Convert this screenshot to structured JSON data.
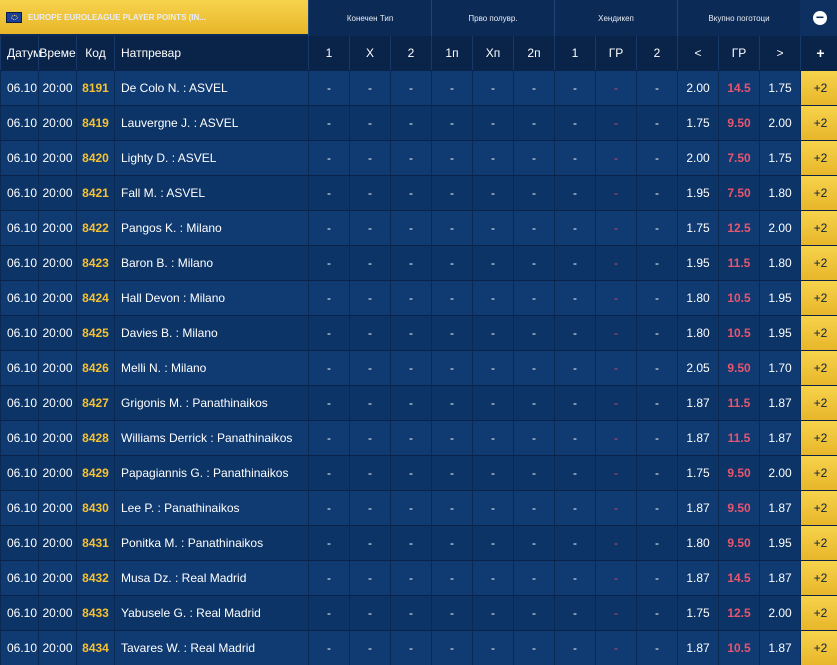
{
  "header": {
    "title": "EUROPE EUROLEAGUE PLAYER POINTS (IN...",
    "groups": [
      "Конечен Тип",
      "Прво полувр.",
      "Хендикеп",
      "Вкупно поготоци"
    ],
    "collapse_symbol": "−"
  },
  "columns": {
    "date": "Датум",
    "time": "Време",
    "code": "Код",
    "match": "Натпревар",
    "ft1": "1",
    "ftx": "X",
    "ft2": "2",
    "h1": "1п",
    "hx": "Хп",
    "h2": "2п",
    "hc1": "1",
    "hcgr": "ГР",
    "hc2": "2",
    "lt": "<",
    "gr": "ГР",
    "gt": ">",
    "plus": "+"
  },
  "rows": [
    {
      "date": "06.10",
      "time": "20:00",
      "code": "8191",
      "match": "De Colo N. : ASVEL",
      "ft1": "-",
      "ftx": "-",
      "ft2": "-",
      "h1": "-",
      "hx": "-",
      "h2": "-",
      "hc1": "-",
      "hcgr": "-",
      "hc2": "-",
      "lt": "2.00",
      "gr": "14.5",
      "gt": "1.75",
      "more": "+2"
    },
    {
      "date": "06.10",
      "time": "20:00",
      "code": "8419",
      "match": "Lauvergne J. : ASVEL",
      "ft1": "-",
      "ftx": "-",
      "ft2": "-",
      "h1": "-",
      "hx": "-",
      "h2": "-",
      "hc1": "-",
      "hcgr": "-",
      "hc2": "-",
      "lt": "1.75",
      "gr": "9.50",
      "gt": "2.00",
      "more": "+2"
    },
    {
      "date": "06.10",
      "time": "20:00",
      "code": "8420",
      "match": "Lighty D. : ASVEL",
      "ft1": "-",
      "ftx": "-",
      "ft2": "-",
      "h1": "-",
      "hx": "-",
      "h2": "-",
      "hc1": "-",
      "hcgr": "-",
      "hc2": "-",
      "lt": "2.00",
      "gr": "7.50",
      "gt": "1.75",
      "more": "+2"
    },
    {
      "date": "06.10",
      "time": "20:00",
      "code": "8421",
      "match": "Fall M. : ASVEL",
      "ft1": "-",
      "ftx": "-",
      "ft2": "-",
      "h1": "-",
      "hx": "-",
      "h2": "-",
      "hc1": "-",
      "hcgr": "-",
      "hc2": "-",
      "lt": "1.95",
      "gr": "7.50",
      "gt": "1.80",
      "more": "+2"
    },
    {
      "date": "06.10",
      "time": "20:00",
      "code": "8422",
      "match": "Pangos K. : Milano",
      "ft1": "-",
      "ftx": "-",
      "ft2": "-",
      "h1": "-",
      "hx": "-",
      "h2": "-",
      "hc1": "-",
      "hcgr": "-",
      "hc2": "-",
      "lt": "1.75",
      "gr": "12.5",
      "gt": "2.00",
      "more": "+2"
    },
    {
      "date": "06.10",
      "time": "20:00",
      "code": "8423",
      "match": "Baron B. : Milano",
      "ft1": "-",
      "ftx": "-",
      "ft2": "-",
      "h1": "-",
      "hx": "-",
      "h2": "-",
      "hc1": "-",
      "hcgr": "-",
      "hc2": "-",
      "lt": "1.95",
      "gr": "11.5",
      "gt": "1.80",
      "more": "+2"
    },
    {
      "date": "06.10",
      "time": "20:00",
      "code": "8424",
      "match": "Hall Devon : Milano",
      "ft1": "-",
      "ftx": "-",
      "ft2": "-",
      "h1": "-",
      "hx": "-",
      "h2": "-",
      "hc1": "-",
      "hcgr": "-",
      "hc2": "-",
      "lt": "1.80",
      "gr": "10.5",
      "gt": "1.95",
      "more": "+2"
    },
    {
      "date": "06.10",
      "time": "20:00",
      "code": "8425",
      "match": "Davies B. : Milano",
      "ft1": "-",
      "ftx": "-",
      "ft2": "-",
      "h1": "-",
      "hx": "-",
      "h2": "-",
      "hc1": "-",
      "hcgr": "-",
      "hc2": "-",
      "lt": "1.80",
      "gr": "10.5",
      "gt": "1.95",
      "more": "+2"
    },
    {
      "date": "06.10",
      "time": "20:00",
      "code": "8426",
      "match": "Melli N. : Milano",
      "ft1": "-",
      "ftx": "-",
      "ft2": "-",
      "h1": "-",
      "hx": "-",
      "h2": "-",
      "hc1": "-",
      "hcgr": "-",
      "hc2": "-",
      "lt": "2.05",
      "gr": "9.50",
      "gt": "1.70",
      "more": "+2"
    },
    {
      "date": "06.10",
      "time": "20:00",
      "code": "8427",
      "match": "Grigonis M. : Panathinaikos",
      "ft1": "-",
      "ftx": "-",
      "ft2": "-",
      "h1": "-",
      "hx": "-",
      "h2": "-",
      "hc1": "-",
      "hcgr": "-",
      "hc2": "-",
      "lt": "1.87",
      "gr": "11.5",
      "gt": "1.87",
      "more": "+2"
    },
    {
      "date": "06.10",
      "time": "20:00",
      "code": "8428",
      "match": "Williams Derrick : Panathinaikos",
      "ft1": "-",
      "ftx": "-",
      "ft2": "-",
      "h1": "-",
      "hx": "-",
      "h2": "-",
      "hc1": "-",
      "hcgr": "-",
      "hc2": "-",
      "lt": "1.87",
      "gr": "11.5",
      "gt": "1.87",
      "more": "+2"
    },
    {
      "date": "06.10",
      "time": "20:00",
      "code": "8429",
      "match": "Papagiannis G. : Panathinaikos",
      "ft1": "-",
      "ftx": "-",
      "ft2": "-",
      "h1": "-",
      "hx": "-",
      "h2": "-",
      "hc1": "-",
      "hcgr": "-",
      "hc2": "-",
      "lt": "1.75",
      "gr": "9.50",
      "gt": "2.00",
      "more": "+2"
    },
    {
      "date": "06.10",
      "time": "20:00",
      "code": "8430",
      "match": "Lee P. : Panathinaikos",
      "ft1": "-",
      "ftx": "-",
      "ft2": "-",
      "h1": "-",
      "hx": "-",
      "h2": "-",
      "hc1": "-",
      "hcgr": "-",
      "hc2": "-",
      "lt": "1.87",
      "gr": "9.50",
      "gt": "1.87",
      "more": "+2"
    },
    {
      "date": "06.10",
      "time": "20:00",
      "code": "8431",
      "match": "Ponitka M. : Panathinaikos",
      "ft1": "-",
      "ftx": "-",
      "ft2": "-",
      "h1": "-",
      "hx": "-",
      "h2": "-",
      "hc1": "-",
      "hcgr": "-",
      "hc2": "-",
      "lt": "1.80",
      "gr": "9.50",
      "gt": "1.95",
      "more": "+2"
    },
    {
      "date": "06.10",
      "time": "20:00",
      "code": "8432",
      "match": "Musa Dz. : Real Madrid",
      "ft1": "-",
      "ftx": "-",
      "ft2": "-",
      "h1": "-",
      "hx": "-",
      "h2": "-",
      "hc1": "-",
      "hcgr": "-",
      "hc2": "-",
      "lt": "1.87",
      "gr": "14.5",
      "gt": "1.87",
      "more": "+2"
    },
    {
      "date": "06.10",
      "time": "20:00",
      "code": "8433",
      "match": "Yabusele G. : Real Madrid",
      "ft1": "-",
      "ftx": "-",
      "ft2": "-",
      "h1": "-",
      "hx": "-",
      "h2": "-",
      "hc1": "-",
      "hcgr": "-",
      "hc2": "-",
      "lt": "1.75",
      "gr": "12.5",
      "gt": "2.00",
      "more": "+2"
    },
    {
      "date": "06.10",
      "time": "20:00",
      "code": "8434",
      "match": "Tavares W. : Real Madrid",
      "ft1": "-",
      "ftx": "-",
      "ft2": "-",
      "h1": "-",
      "hx": "-",
      "h2": "-",
      "hc1": "-",
      "hcgr": "-",
      "hc2": "-",
      "lt": "1.87",
      "gr": "10.5",
      "gt": "1.87",
      "more": "+2"
    }
  ],
  "colors": {
    "accent": "#f6c233",
    "total_line": "#e8556f",
    "background": "#0b2a55"
  }
}
